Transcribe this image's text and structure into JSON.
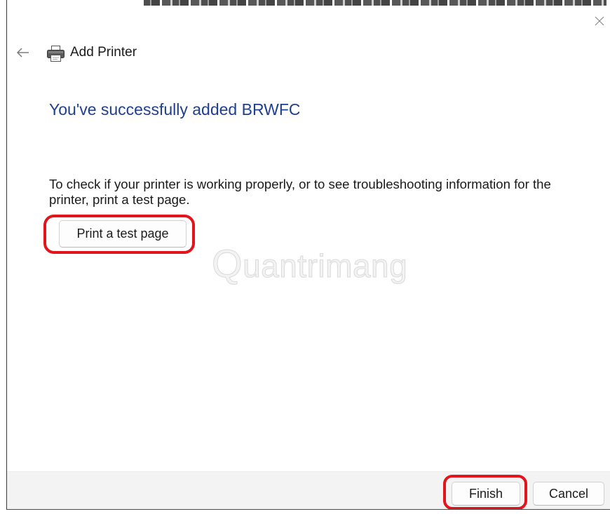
{
  "dialog": {
    "title": "Add Printer",
    "heading": "You've successfully added BRWFC",
    "message": "To check if your printer is working properly, or to see troubleshooting information for the printer, print a test page.",
    "test_page_button": "Print a test page"
  },
  "footer": {
    "finish_label": "Finish",
    "cancel_label": "Cancel"
  },
  "watermark": "Quantrimang",
  "icons": {
    "close": "close-icon",
    "back": "back-arrow-icon",
    "printer": "printer-icon"
  },
  "colors": {
    "heading": "#1f3f8f",
    "highlight_ring": "#e3141c",
    "footer_background": "#f3f3f3"
  }
}
